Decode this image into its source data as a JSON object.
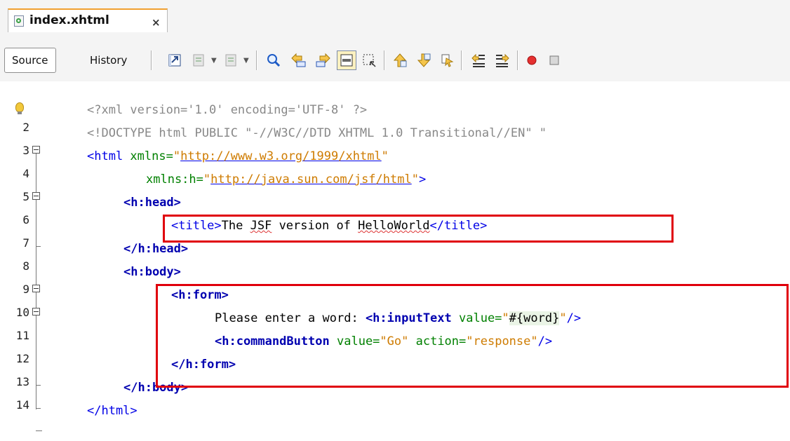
{
  "tab": {
    "filename": "index.xhtml",
    "close_glyph": "×"
  },
  "toolbar": {
    "source_label": "Source",
    "history_label": "History",
    "icons": [
      "last-edit-icon",
      "back-icon",
      "forward-icon",
      "find-selection-icon",
      "find-previous-icon",
      "find-next-icon",
      "toggle-highlight-icon",
      "toggle-rect-select-icon",
      "previous-bookmark-icon",
      "next-bookmark-icon",
      "toggle-bookmark-icon",
      "shift-left-icon",
      "shift-right-icon",
      "start-macro-icon",
      "stop-macro-icon"
    ]
  },
  "editor": {
    "line_numbers": [
      "2",
      "3",
      "4",
      "5",
      "6",
      "7",
      "8",
      "9",
      "10",
      "11",
      "12",
      "13",
      "14"
    ],
    "lines": {
      "l1_xmldecl": "<?xml version='1.0' encoding='UTF-8' ?>",
      "l2_doctype": "<!DOCTYPE html PUBLIC \"-//W3C//DTD XHTML 1.0 Transitional//EN\" \"",
      "l3_open": "<html ",
      "l3_attr": "xmlns=",
      "l3_q1": "\"",
      "l3_url": "http://www.w3.org/1999/xhtml",
      "l3_q2": "\"",
      "l4_attr": "xmlns:h=",
      "l4_q1": "\"",
      "l4_url": "http://java.sun.com/jsf/html",
      "l4_q2": "\"",
      "l4_close": ">",
      "l5": "<h:head>",
      "l6_open": "<title>",
      "l6_text1": "The ",
      "l6_jsf": "JSF",
      "l6_text2": " version of ",
      "l6_hw": "HelloWorld",
      "l6_close": "</title>",
      "l7": "</h:head>",
      "l8": "<h:body>",
      "l9": "<h:form>",
      "l10_text": "Please enter a word: ",
      "l10_tag": "<h:inputText ",
      "l10_attr": "value=",
      "l10_q1": "\"",
      "l10_expr": "#{word}",
      "l10_q2": "\"",
      "l10_end": "/>",
      "l11_tag": "<h:commandButton ",
      "l11_attr1": "value=",
      "l11_val1": "\"Go\"",
      "l11_attr2": " action=",
      "l11_val2": "\"response\"",
      "l11_end": "/>",
      "l12": "</h:form>",
      "l13": "</h:body>",
      "l14": "</html>"
    }
  },
  "colors": {
    "tab_accent": "#f0a030",
    "highlight_box": "#e0000b",
    "tag": "#0000e6",
    "attribute": "#008000",
    "string": "#ce7b00"
  }
}
